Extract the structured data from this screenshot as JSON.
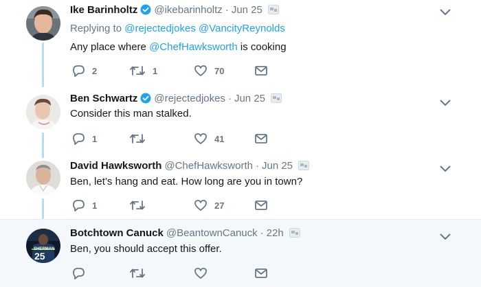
{
  "tweets": [
    {
      "name": "Ike Barinholtz",
      "verified": true,
      "handle": "@ikebarinholtz",
      "sep": "·",
      "time": "Jun 25",
      "reply_prefix": "Replying to",
      "reply_handles": [
        "@rejectedjokes",
        "@VancityReynolds"
      ],
      "text_before": "Any place where ",
      "text_mention": "@ChefHawksworth",
      "text_after": " is cooking",
      "replies": "2",
      "retweets": "1",
      "likes": "70",
      "highlighted": false
    },
    {
      "name": "Ben Schwartz",
      "verified": true,
      "handle": "@rejectedjokes",
      "sep": "·",
      "time": "Jun 25",
      "text": "Consider this man stalked.",
      "replies": "1",
      "retweets": "",
      "likes": "41",
      "highlighted": false
    },
    {
      "name": "David Hawksworth",
      "verified": false,
      "handle": "@ChefHawksworth",
      "sep": "·",
      "time": "Jun 25",
      "text": "Ben, let’s hang and eat. How long are you in town?",
      "replies": "1",
      "retweets": "",
      "likes": "27",
      "highlighted": false
    },
    {
      "name": "Botchtown Canuck",
      "verified": false,
      "handle": "@BeantownCanuck",
      "sep": "·",
      "time": "22h",
      "text": "Ben, you should accept this offer.",
      "replies": "",
      "retweets": "",
      "likes": "",
      "highlighted": true,
      "avatar_jersey_text": "SHERMAN",
      "avatar_jersey_number": "25"
    }
  ],
  "icons": {
    "verified": "verified-badge-icon",
    "translate": "translate-icon",
    "caret": "chevron-down-icon",
    "reply": "reply-icon",
    "retweet": "retweet-icon",
    "like": "heart-icon",
    "dm": "envelope-icon"
  },
  "colors": {
    "link": "#1da1f2",
    "muted": "#657786",
    "thread_line": "#b3dcf7",
    "highlight_bg": "#f5f8fa"
  }
}
